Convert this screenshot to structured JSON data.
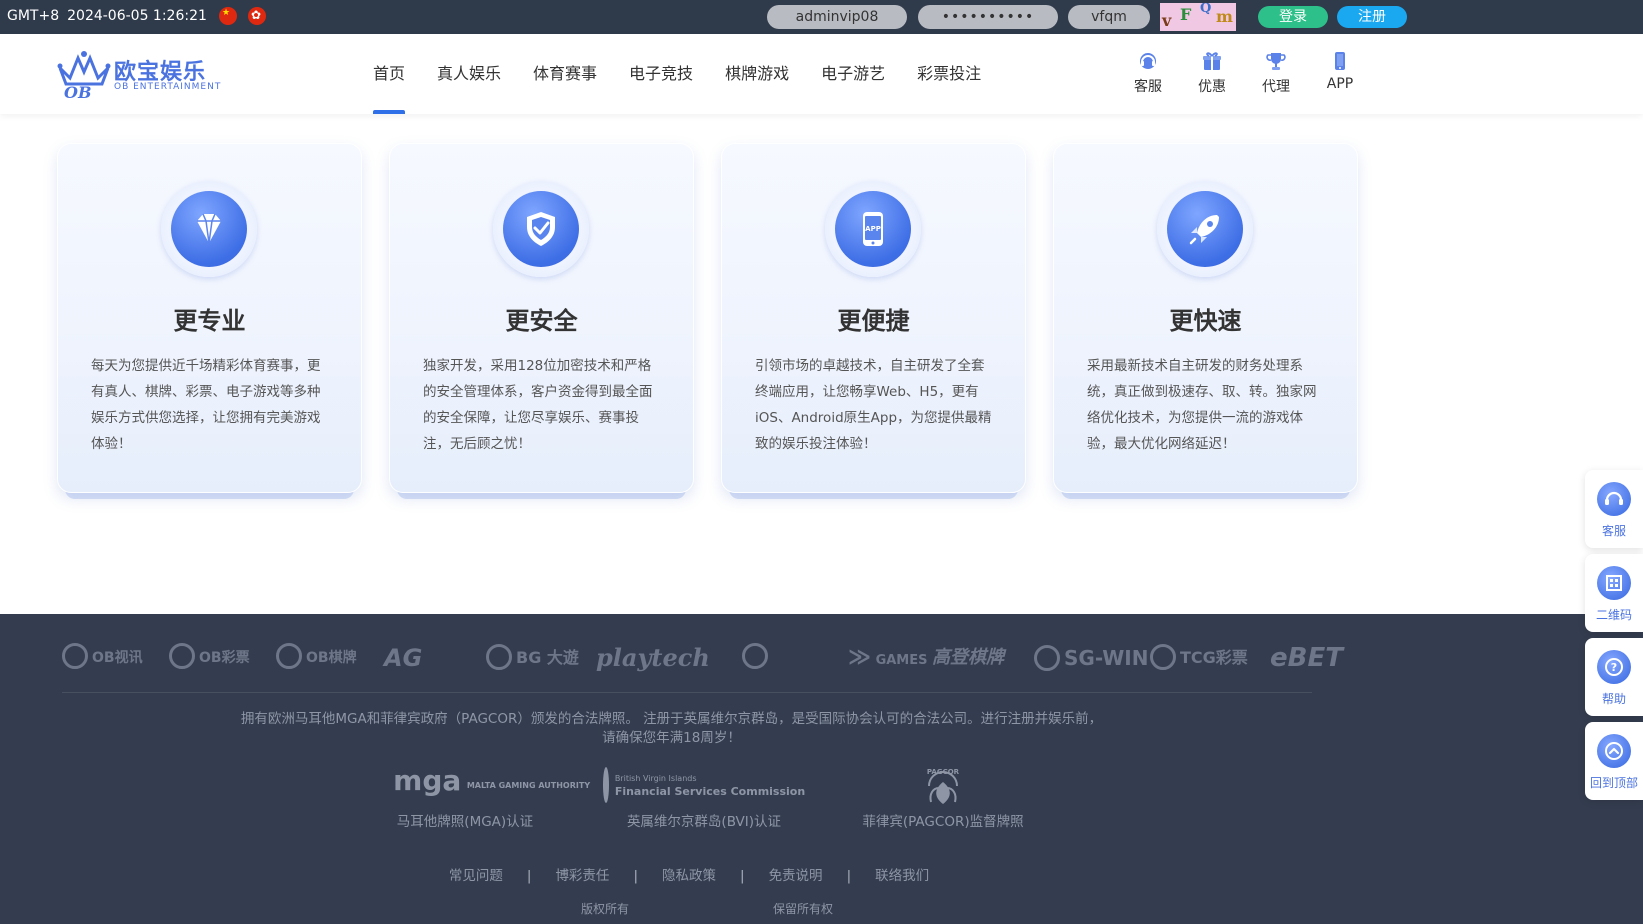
{
  "topbar": {
    "timezone": "GMT+8",
    "datetime": "2024-06-05 1:26:21",
    "username_value": "adminvip08",
    "password_value": "••••••••••",
    "captcha_value": "vfqm",
    "captcha_chars": [
      "v",
      "F",
      "Q",
      "m"
    ],
    "login_label": "登录",
    "register_label": "注册"
  },
  "header": {
    "logo_cn": "欧宝娱乐",
    "logo_en": "OB ENTERTAINMENT",
    "logo_mark": "OB",
    "nav": [
      "首页",
      "真人娱乐",
      "体育赛事",
      "电子竞技",
      "棋牌游戏",
      "电子游艺",
      "彩票投注"
    ],
    "active_nav": "首页",
    "quick_links": [
      "客服",
      "优惠",
      "代理",
      "APP"
    ]
  },
  "features": [
    {
      "title": "更专业",
      "icon": "diamond-icon",
      "desc": "每天为您提供近千场精彩体育赛事，更有真人、棋牌、彩票、电子游戏等多种娱乐方式供您选择，让您拥有完美游戏体验！"
    },
    {
      "title": "更安全",
      "icon": "shield-check-icon",
      "desc": "独家开发，采用128位加密技术和严格的安全管理体系，客户资金得到最全面的安全保障，让您尽享娱乐、赛事投注，无后顾之忧！"
    },
    {
      "title": "更便捷",
      "icon": "app-phone-icon",
      "icon_text": "APP",
      "desc": "引领市场的卓越技术，自主研发了全套终端应用，让您畅享Web、H5，更有iOS、Android原生App，为您提供最精致的娱乐投注体验！"
    },
    {
      "title": "更快速",
      "icon": "rocket-icon",
      "desc": "采用最新技术自主研发的财务处理系统，真正做到极速存、取、转。独家网络优化技术，为您提供一流的游戏体验，最大优化网络延迟！"
    }
  ],
  "footer": {
    "partners": [
      "OB视讯",
      "OB彩票",
      "OB棋牌",
      "AG",
      "BG 大遊",
      "playtech",
      "",
      "GAMES",
      "高登棋牌",
      "SG-WIN",
      "TCG彩票",
      "eBET"
    ],
    "license_text_1": "拥有欧洲马耳他MGA和菲律宾政府（PAGCOR）颁发的合法牌照。 注册于英属维尔京群岛，是受国际协会认可的合法公司。进行注册并娱乐前，",
    "license_text_2": "请确保您年满18周岁！",
    "badges": [
      {
        "logo": "mga",
        "logo_sub": "MALTA GAMING AUTHORITY",
        "label": "马耳他牌照(MGA)认证"
      },
      {
        "logo": "British Virgin Islands",
        "logo_sub": "Financial Services Commission",
        "label": "英属维尔京群岛(BVI)认证"
      },
      {
        "logo": "PAGCOR",
        "logo_sub": "",
        "label": "菲律宾(PAGCOR)监督牌照"
      }
    ],
    "links": [
      "常见问题",
      "博彩责任",
      "隐私政策",
      "免责说明",
      "联络我们"
    ],
    "copyright_left": "版权所有",
    "copyright_right": "保留所有权"
  },
  "float_panel": [
    "客服",
    "二维码",
    "帮助",
    "回到顶部"
  ],
  "colors": {
    "topbar_bg": "#2f3a4b",
    "accent_blue": "#2f6fe8",
    "login_green": "#2ec08a",
    "register_blue": "#1aa8f0",
    "footer_bg": "#343d4f"
  }
}
